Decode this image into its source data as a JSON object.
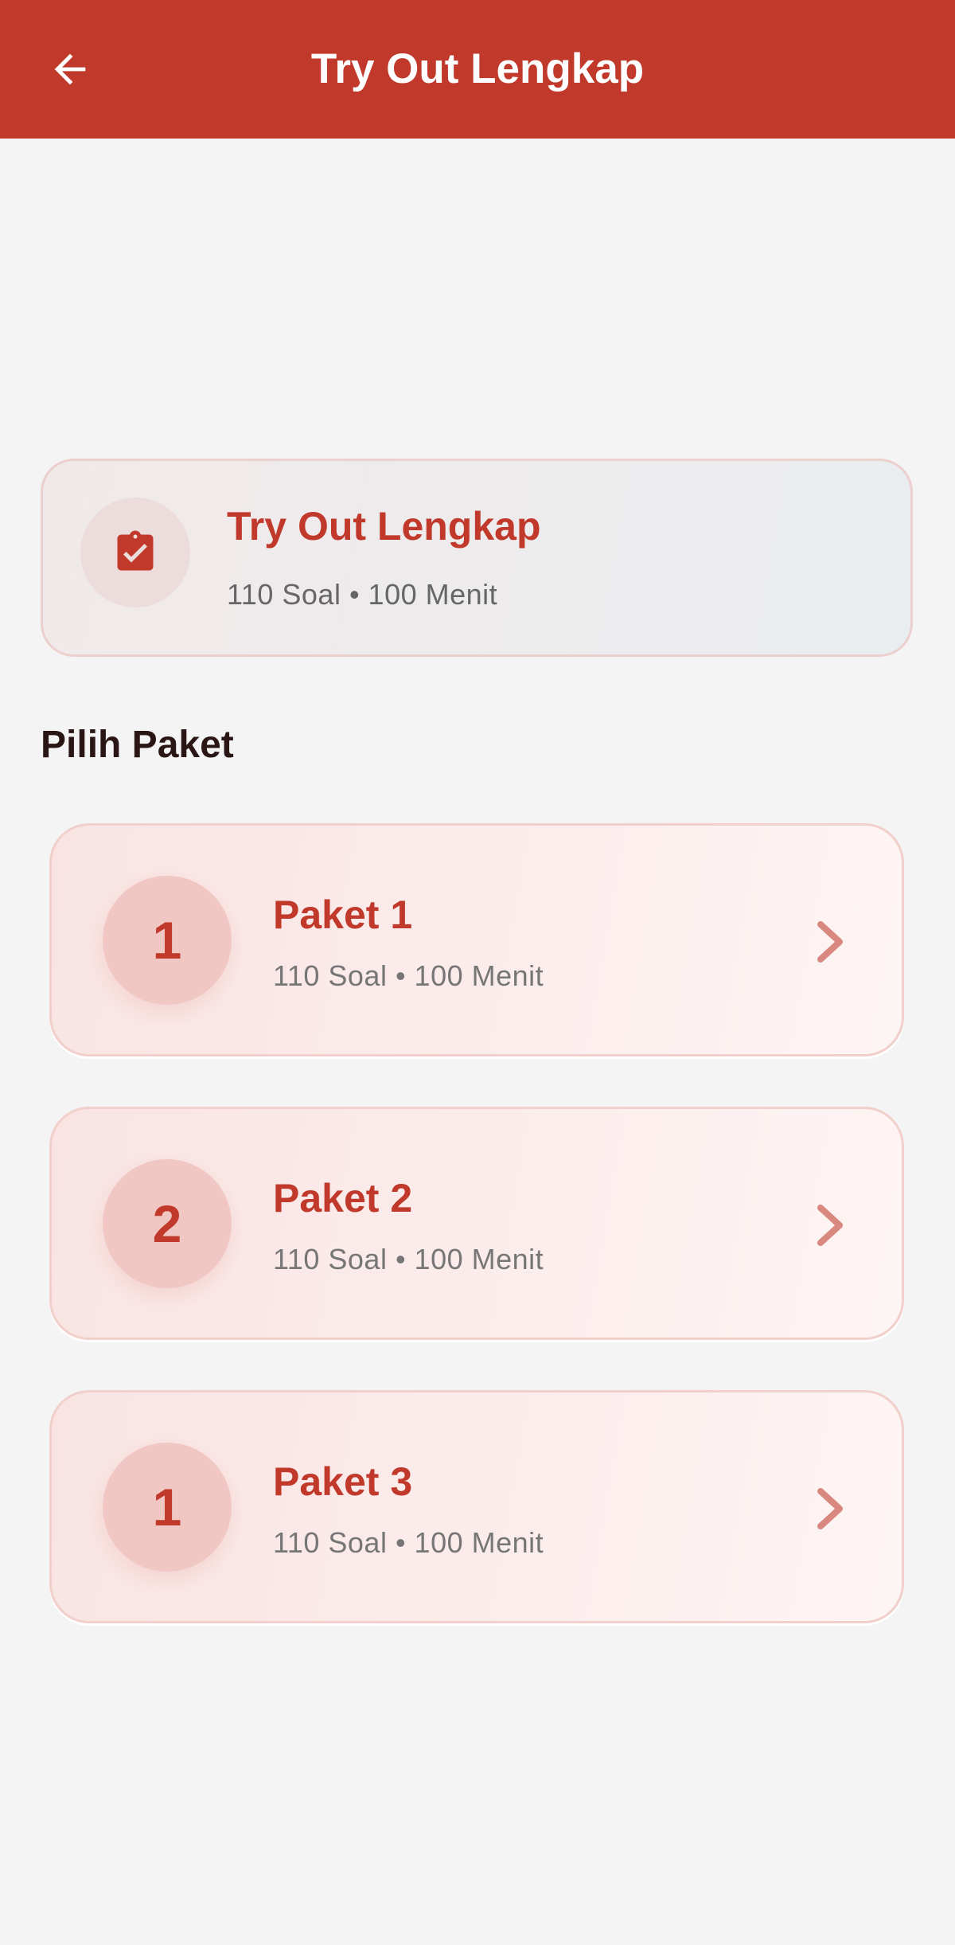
{
  "appbar": {
    "title": "Try Out Lengkap",
    "back_icon": "arrow-left-icon",
    "background": "#c0392b"
  },
  "summary": {
    "icon": "clipboard-check-icon",
    "title": "Try Out Lengkap",
    "meta": "110 Soal • 100 Menit"
  },
  "section": {
    "title": "Pilih Paket"
  },
  "pakets": [
    {
      "number": "1",
      "title": "Paket 1",
      "meta": "110 Soal • 100 Menit",
      "chevron": "chevron-right-icon"
    },
    {
      "number": "2",
      "title": "Paket 2",
      "meta": "110 Soal • 100 Menit",
      "chevron": "chevron-right-icon"
    },
    {
      "number": "1",
      "title": "Paket 3",
      "meta": "110 Soal • 100 Menit",
      "chevron": "chevron-right-icon"
    }
  ],
  "colors": {
    "accent": "#c0392b",
    "page_background": "#f4f4f4"
  }
}
